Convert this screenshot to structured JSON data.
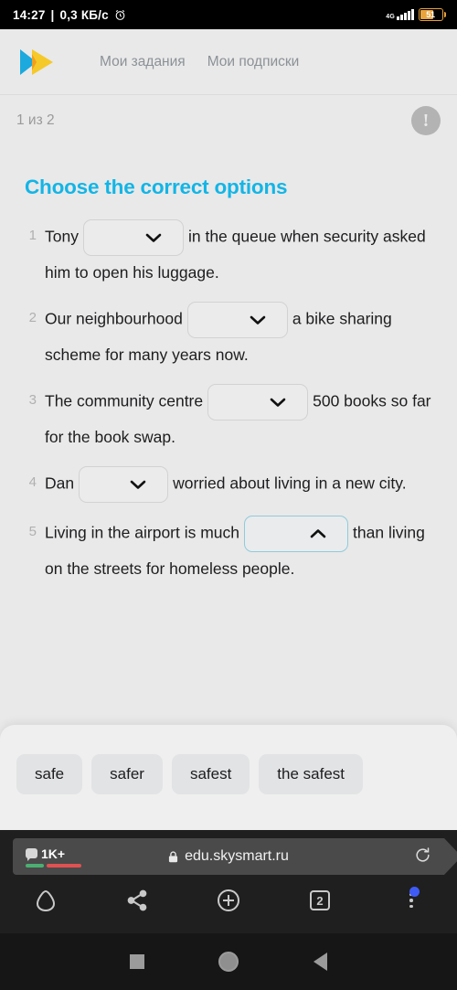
{
  "status_bar": {
    "time": "14:27",
    "separator": "|",
    "network_speed": "0,3 КБ/с",
    "alarm_icon": "alarm-icon",
    "network_type": "4G",
    "battery_level": "51"
  },
  "site_header": {
    "logo": "skysmart-logo",
    "logo_colors": {
      "blue": "#1ca9dd",
      "yellow": "#f5c518",
      "orange": "#f0a01e"
    },
    "nav": [
      {
        "label": "Мои задания",
        "name": "nav-my-tasks"
      },
      {
        "label": "Мои подписки",
        "name": "nav-my-subscriptions"
      }
    ]
  },
  "progress": {
    "label": "1 из 2",
    "alert_icon": "exclamation-circle-icon",
    "alert_glyph": "!"
  },
  "exercise": {
    "title": "Choose the correct options",
    "title_color": "#13b5e6",
    "questions": [
      {
        "number": "1",
        "before": "Tony",
        "after": "in the queue when security asked him to open his luggage.",
        "dropdown_state": "closed",
        "dropdown_value": ""
      },
      {
        "number": "2",
        "before": "Our neighbourhood",
        "after": "a bike sharing scheme for many years now.",
        "dropdown_state": "closed",
        "dropdown_value": ""
      },
      {
        "number": "3",
        "before": "The community centre",
        "after": "500 books so far for the book swap.",
        "dropdown_state": "closed",
        "dropdown_value": ""
      },
      {
        "number": "4",
        "before": "Dan",
        "after": "worried about living in a new city.",
        "dropdown_state": "closed",
        "dropdown_value": ""
      },
      {
        "number": "5",
        "before": "Living in the airport is much",
        "after": "than living on the streets for homeless people.",
        "dropdown_state": "open",
        "dropdown_value": ""
      }
    ]
  },
  "options_panel": {
    "active_question": "5",
    "options": [
      {
        "label": "safe"
      },
      {
        "label": "safer"
      },
      {
        "label": "safest"
      },
      {
        "label": "the safest"
      }
    ]
  },
  "browser": {
    "chat_badge": "1K+",
    "lock_icon": "lock-icon",
    "url": "edu.skysmart.ru",
    "reload_icon": "reload-icon",
    "buttons": [
      {
        "name": "home-icon",
        "label": ""
      },
      {
        "name": "share-icon",
        "label": ""
      },
      {
        "name": "new-tab-icon",
        "label": ""
      },
      {
        "name": "tab-count-icon",
        "label": "2"
      },
      {
        "name": "menu-kebab-icon",
        "label": ""
      }
    ]
  },
  "android_nav": {
    "recents_icon": "recents-square-icon",
    "home_icon": "home-circle-icon",
    "back_icon": "back-triangle-icon"
  }
}
